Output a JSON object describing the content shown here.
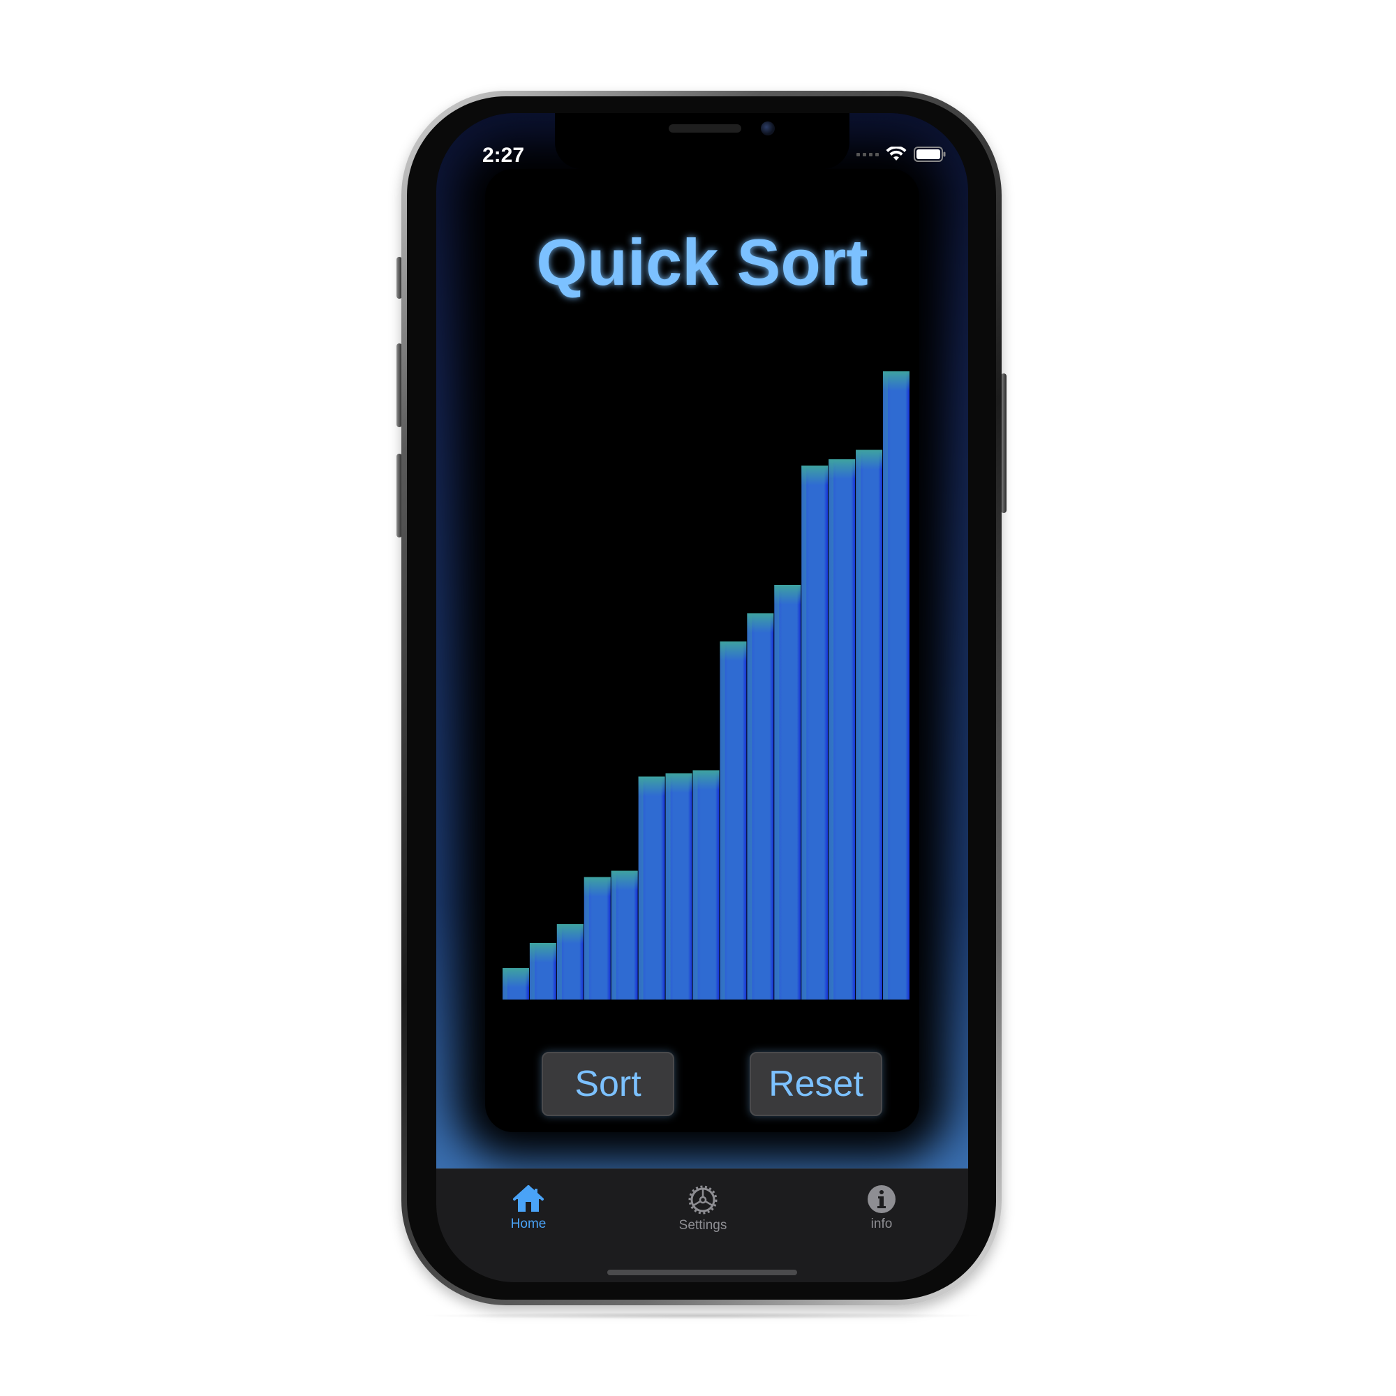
{
  "status_bar": {
    "time": "2:27"
  },
  "title": "Quick Sort",
  "chart_data": {
    "type": "bar",
    "values": [
      5,
      9,
      12,
      19.5,
      20.5,
      35.5,
      36,
      36.5,
      57,
      61.5,
      66,
      85,
      86,
      87.5,
      100
    ],
    "ylim": [
      0,
      100
    ],
    "title": "",
    "xlabel": "",
    "ylabel": "",
    "grid": false,
    "colors": {
      "bar_base": "#2d6bd4",
      "bar_edge": "#1234d8",
      "bar_top": "#3fa3a0"
    }
  },
  "buttons": {
    "sort_label": "Sort",
    "reset_label": "Reset"
  },
  "tabs": [
    {
      "label": "Home",
      "icon": "house-icon",
      "active": true
    },
    {
      "label": "Settings",
      "icon": "gear-icon",
      "active": false
    },
    {
      "label": "info",
      "icon": "info-icon",
      "active": false
    }
  ],
  "colors": {
    "accent": "#7cc1ff",
    "tab_active": "#4aa3f7",
    "tab_inactive": "#8e8e93",
    "button_bg": "#3a3a3c",
    "tab_bar_bg": "#1c1c1e"
  }
}
